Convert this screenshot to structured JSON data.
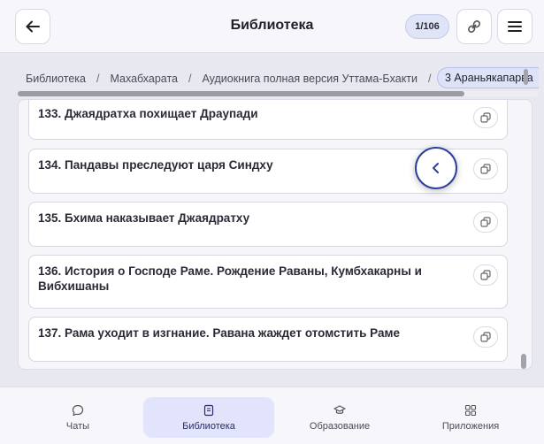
{
  "header": {
    "title": "Библиотека",
    "counter": "1/106"
  },
  "breadcrumbs": {
    "items": [
      "Библиотека",
      "Махабхарата",
      "Аудиокнига полная версия Уттама-Бхакти"
    ],
    "separator": "/",
    "active": "3 Араньякапарва"
  },
  "chapters": [
    {
      "title": "133. Джаядратха похищает Драупади"
    },
    {
      "title": "134. Пандавы преследуют царя Синдху"
    },
    {
      "title": "135. Бхима наказывает Джаядратху"
    },
    {
      "title": "136. История о Господе Раме. Рождение Раваны, Кумбхакарны и Вибхишаны"
    },
    {
      "title": "137. Рама уходит в изгнание. Равана жаждет отомстить Раме"
    }
  ],
  "nav": {
    "chats": "Чаты",
    "library": "Библиотека",
    "education": "Образование",
    "apps": "Приложения"
  },
  "colors": {
    "accent": "#2e3f9a",
    "active_nav_bg": "#e2e4fb",
    "background": "#e7e8f0"
  },
  "icons": {
    "back": "arrow-left-icon",
    "link": "link-icon",
    "menu": "hamburger-icon",
    "copy": "copy-icon",
    "float_back": "chevron-left-icon"
  }
}
